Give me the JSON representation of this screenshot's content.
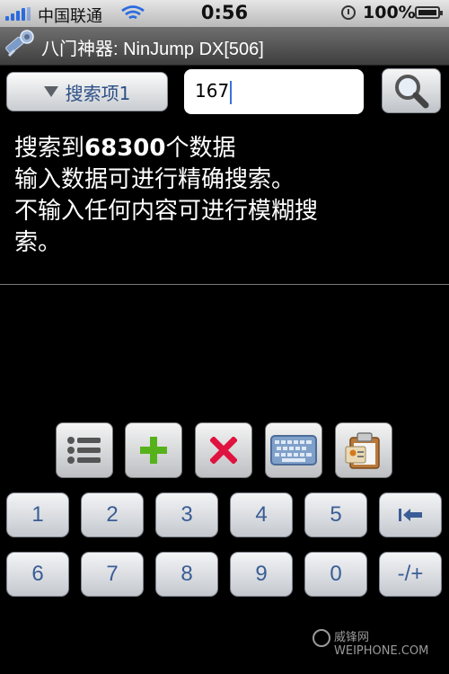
{
  "status_bar": {
    "carrier": "中国联通",
    "time": "0:56",
    "battery": "100%"
  },
  "title_bar": {
    "title": "八门神器: NinJump DX[506]"
  },
  "search": {
    "dropdown_label": "搜索项1",
    "input_value": "167"
  },
  "info": {
    "prefix": "搜索到",
    "count": "68300",
    "suffix": "个数据",
    "line2": "输入数据可进行精确搜索。",
    "line3": "不输入任何内容可进行模糊搜",
    "line4": "索。"
  },
  "tools": [
    {
      "icon": "list-icon"
    },
    {
      "icon": "plus-icon",
      "color": "#56b21a"
    },
    {
      "icon": "close-icon",
      "color": "#e0123f"
    },
    {
      "icon": "keyboard-icon"
    },
    {
      "icon": "clipboard-icon"
    }
  ],
  "keypad": {
    "row1": [
      "1",
      "2",
      "3",
      "4",
      "5"
    ],
    "row2": [
      "6",
      "7",
      "8",
      "9",
      "0",
      "-/+"
    ],
    "backspace_icon": "backspace-icon"
  },
  "watermark": {
    "text": "威锋网 WEIPHONE.COM"
  }
}
